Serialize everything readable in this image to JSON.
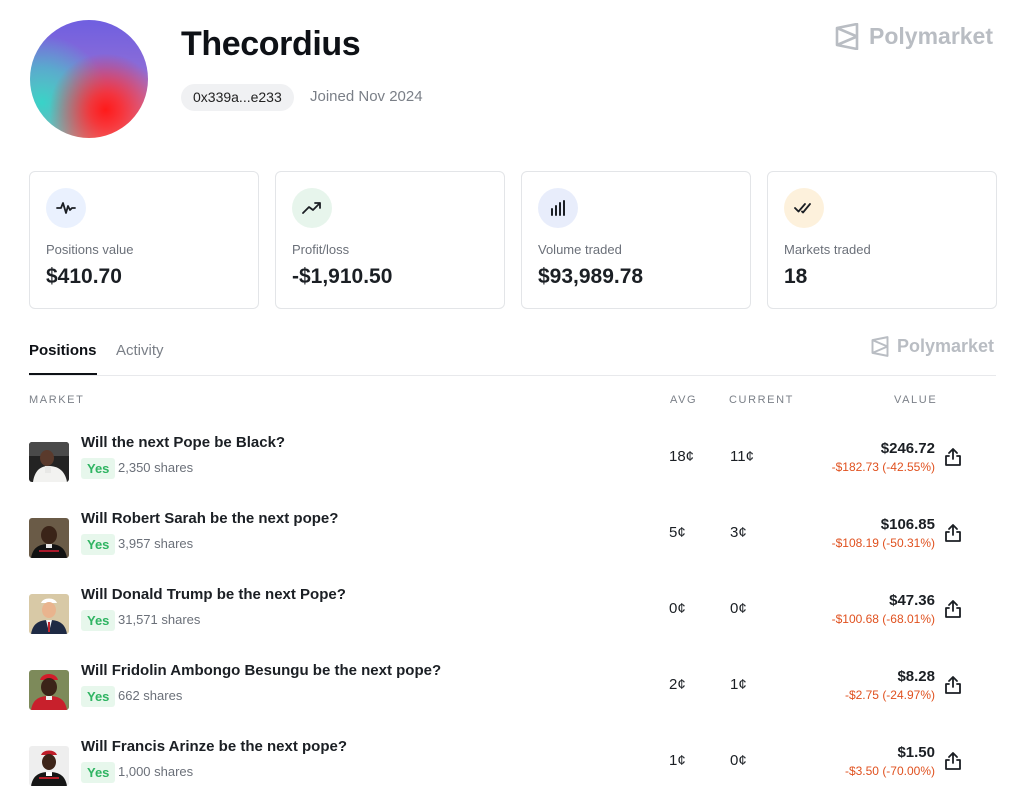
{
  "profile": {
    "username": "Thecordius",
    "address": "0x339a...e233",
    "joined": "Joined Nov 2024"
  },
  "brand": {
    "name": "Polymarket",
    "logo_color": "#b9bdc3"
  },
  "stats": [
    {
      "label": "Positions value",
      "value": "$410.70",
      "icon": "activity-icon",
      "icon_bg": "#eaf1fe"
    },
    {
      "label": "Profit/loss",
      "value": "-$1,910.50",
      "icon": "trending-up-icon",
      "icon_bg": "#e7f5ec"
    },
    {
      "label": "Volume traded",
      "value": "$93,989.78",
      "icon": "bar-chart-icon",
      "icon_bg": "#e8edfb"
    },
    {
      "label": "Markets traded",
      "value": "18",
      "icon": "double-check-icon",
      "icon_bg": "#fdf1dc"
    }
  ],
  "tabs": [
    {
      "label": "Positions",
      "active": true
    },
    {
      "label": "Activity",
      "active": false
    }
  ],
  "table": {
    "headers": {
      "market": "MARKET",
      "avg": "AVG",
      "current": "CURRENT",
      "value": "VALUE"
    },
    "rows": [
      {
        "title": "Will the next Pope be Black?",
        "outcome": "Yes",
        "shares": "2,350 shares",
        "avg": "18¢",
        "current": "11¢",
        "value": "$246.72",
        "pnl": "-$182.73 (-42.55%)"
      },
      {
        "title": "Will Robert Sarah be the next pope?",
        "outcome": "Yes",
        "shares": "3,957 shares",
        "avg": "5¢",
        "current": "3¢",
        "value": "$106.85",
        "pnl": "-$108.19 (-50.31%)"
      },
      {
        "title": "Will Donald Trump be the next Pope?",
        "outcome": "Yes",
        "shares": "31,571 shares",
        "avg": "0¢",
        "current": "0¢",
        "value": "$47.36",
        "pnl": "-$100.68 (-68.01%)"
      },
      {
        "title": "Will Fridolin Ambongo Besungu be the next pope?",
        "outcome": "Yes",
        "shares": "662 shares",
        "avg": "2¢",
        "current": "1¢",
        "value": "$8.28",
        "pnl": "-$2.75 (-24.97%)"
      },
      {
        "title": "Will Francis Arinze be the next pope?",
        "outcome": "Yes",
        "shares": "1,000 shares",
        "avg": "1¢",
        "current": "0¢",
        "value": "$1.50",
        "pnl": "-$3.50 (-70.00%)"
      }
    ]
  },
  "colors": {
    "loss": "#e0511f",
    "yes_text": "#2fb462",
    "yes_bg": "#e7f7ec"
  }
}
